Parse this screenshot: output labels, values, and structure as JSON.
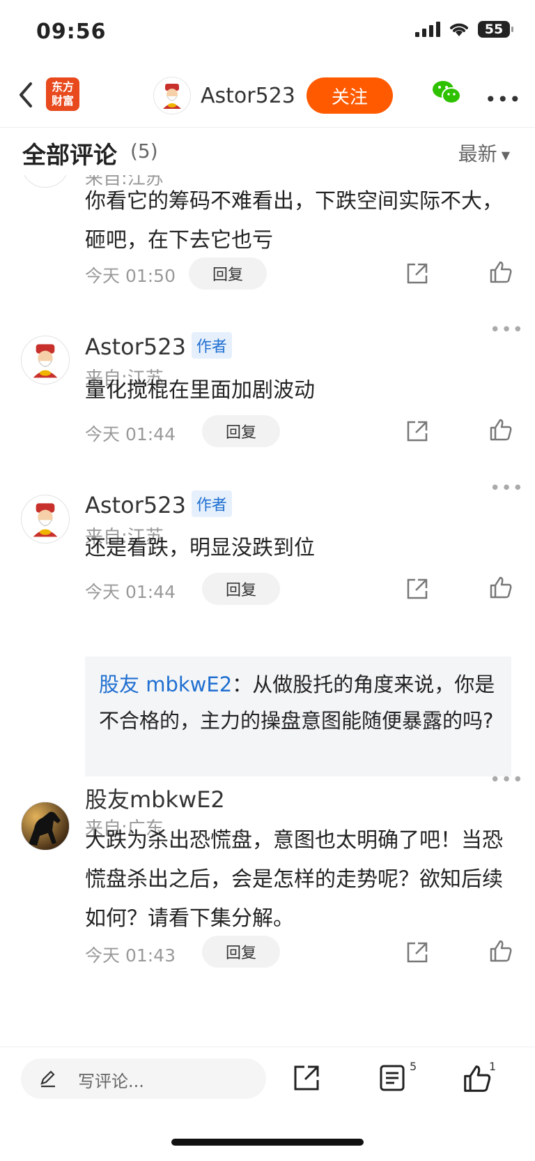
{
  "status_bar": {
    "time": "09:56",
    "battery": "55"
  },
  "nav": {
    "logo_line1": "东方",
    "logo_line2": "财富",
    "username": "Astor523",
    "follow_label": "关注"
  },
  "section": {
    "title": "全部评论",
    "count": "(5)",
    "sort": "最新"
  },
  "comments": [
    {
      "location": "来自:江苏",
      "text": "你看它的筹码不难看出，下跌空间实际不大，砸吧，在下去它也亏",
      "time": "今天 01:50",
      "reply": "回复"
    },
    {
      "user": "Astor523",
      "tag": "作者",
      "location": "来自:江苏",
      "text": "量化搅棍在里面加剧波动",
      "time": "今天 01:44",
      "reply": "回复"
    },
    {
      "user": "Astor523",
      "tag": "作者",
      "location": "来自:江苏",
      "text": "还是看跌，明显没跌到位",
      "time": "今天 01:44",
      "reply": "回复",
      "quote": {
        "user": "股友 mbkwE2",
        "sep": "：",
        "text": "从做股托的角度来说，你是不合格的，主力的操盘意图能随便暴露的吗?"
      }
    },
    {
      "user": "股友mbkwE2",
      "location": "来自:广东",
      "text": "大跌为杀出恐慌盘，意图也太明确了吧！当恐慌盘杀出之后，会是怎样的走势呢？欲知后续如何？请看下集分解。",
      "time": "今天 01:43",
      "reply": "回复"
    }
  ],
  "bottom": {
    "placeholder": "写评论...",
    "comment_count": "5",
    "like_count": "1"
  }
}
